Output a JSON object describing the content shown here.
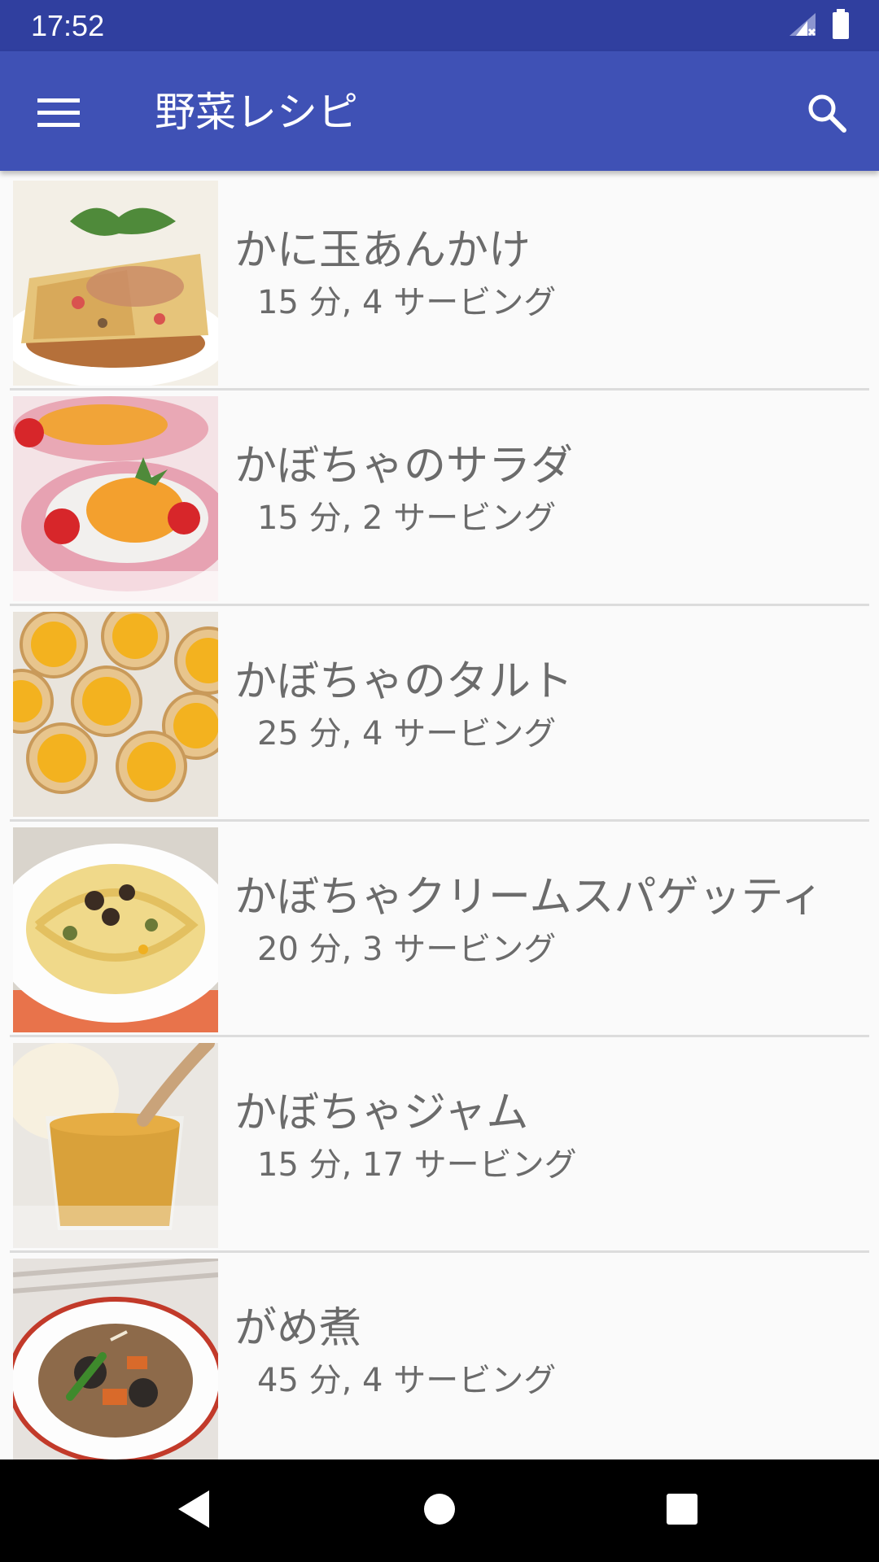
{
  "status_bar": {
    "time": "17:52",
    "icons": [
      "signal-icon",
      "battery-icon"
    ]
  },
  "app_bar": {
    "title": "野菜レシピ",
    "icons": [
      "menu-icon",
      "search-icon"
    ],
    "color": "#3f51b5",
    "status_color": "#303f9f"
  },
  "recipes": [
    {
      "name": "かに玉あんかけ",
      "meta": "15 分, 4 サービング"
    },
    {
      "name": "かぼちゃのサラダ",
      "meta": "15 分, 2 サービング"
    },
    {
      "name": "かぼちゃのタルト",
      "meta": "25 分, 4 サービング"
    },
    {
      "name": "かぼちゃクリームスパゲッティ",
      "meta": "20 分, 3 サービング"
    },
    {
      "name": "かぼちゃジャム",
      "meta": "15 分, 17 サービング"
    },
    {
      "name": "がめ煮",
      "meta": "45 分, 4 サービング"
    }
  ],
  "nav_bar": {
    "icons": [
      "back-icon",
      "home-icon",
      "recents-icon"
    ]
  }
}
